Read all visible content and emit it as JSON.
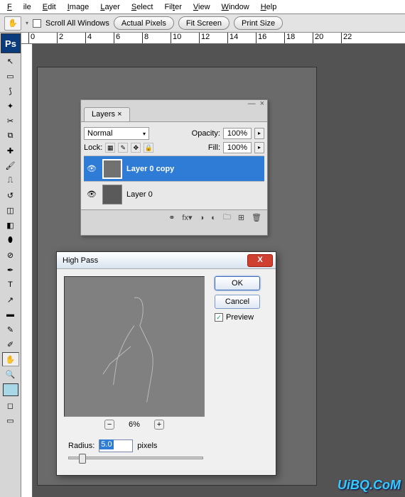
{
  "menu": {
    "file": "File",
    "edit": "Edit",
    "image": "Image",
    "layer": "Layer",
    "select": "Select",
    "filter": "Filter",
    "view": "View",
    "window": "Window",
    "help": "Help"
  },
  "options": {
    "scroll_all": "Scroll All Windows",
    "actual": "Actual Pixels",
    "fit": "Fit Screen",
    "print": "Print Size"
  },
  "ruler_marks": [
    "0",
    "2",
    "4",
    "6",
    "8",
    "10",
    "12",
    "14",
    "16",
    "18",
    "20",
    "22"
  ],
  "ps_badge": "Ps",
  "layers_panel": {
    "tab": "Layers",
    "blend": "Normal",
    "opacity_lbl": "Opacity:",
    "opacity": "100%",
    "lock_lbl": "Lock:",
    "fill_lbl": "Fill:",
    "fill": "100%",
    "layers": [
      {
        "name": "Layer 0 copy",
        "selected": true
      },
      {
        "name": "Layer 0",
        "selected": false
      }
    ]
  },
  "dialog": {
    "title": "High Pass",
    "ok": "OK",
    "cancel": "Cancel",
    "preview": "Preview",
    "zoom": "6%",
    "radius_lbl": "Radius:",
    "radius_val": "5.0",
    "radius_unit": "pixels"
  },
  "watermark": "UiBQ.CoM"
}
